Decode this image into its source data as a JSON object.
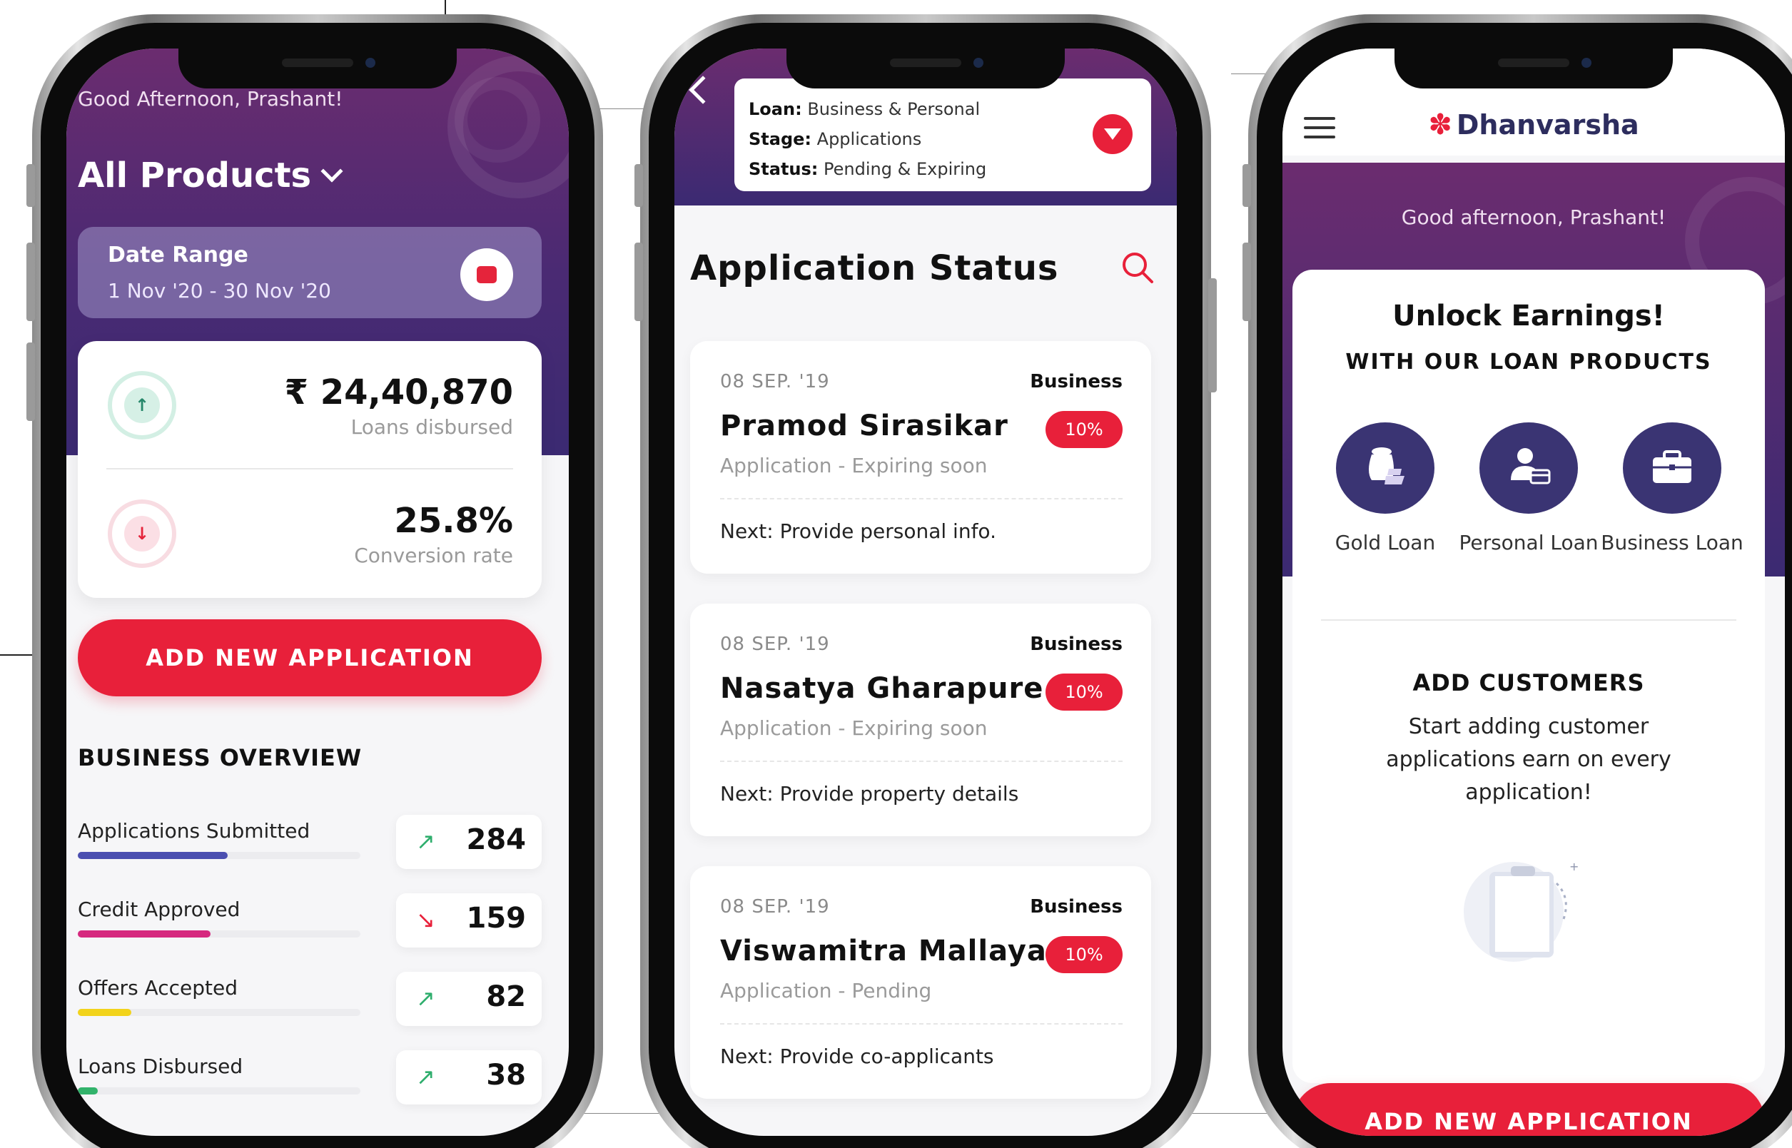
{
  "colors": {
    "brand_red": "#e8203a",
    "brand_purple": "#4a2a73",
    "navy_icon": "#3a3473"
  },
  "dashboard": {
    "greeting": "Good Afternoon, Prashant!",
    "product_selector": "All Products",
    "date_range": {
      "title": "Date Range",
      "value": "1 Nov '20 - 30 Nov '20"
    },
    "stats": [
      {
        "value": "₹ 24,40,870",
        "label": "Loans disbursed",
        "icon": "arrow-up-icon"
      },
      {
        "value": "25.8%",
        "label": "Conversion rate",
        "icon": "arrow-down-icon"
      }
    ],
    "add_button": "ADD NEW APPLICATION",
    "overview_title": "BUSINESS OVERVIEW",
    "overview": [
      {
        "label": "Applications Submitted",
        "value": "284",
        "trend": "up",
        "progress": 0.53,
        "color": "#4b4fb0"
      },
      {
        "label": "Credit Approved",
        "value": "159",
        "trend": "down",
        "progress": 0.47,
        "color": "#d6297f"
      },
      {
        "label": "Offers Accepted",
        "value": "82",
        "trend": "up",
        "progress": 0.19,
        "color": "#f2d31b"
      },
      {
        "label": "Loans Disbursed",
        "value": "38",
        "trend": "up",
        "progress": 0.07,
        "color": "#32b36b"
      }
    ]
  },
  "status_screen": {
    "filter": {
      "loan_label": "Loan:",
      "loan_value": "Business & Personal",
      "stage_label": "Stage:",
      "stage_value": "Applications",
      "status_label": "Status:",
      "status_value": "Pending & Expiring"
    },
    "title": "Application Status",
    "applications": [
      {
        "date": "08 SEP. '19",
        "type": "Business",
        "name": "Pramod Sirasikar",
        "badge": "10%",
        "status": "Application - Expiring soon",
        "next": "Next: Provide personal info."
      },
      {
        "date": "08 SEP. '19",
        "type": "Business",
        "name": "Nasatya Gharapure",
        "badge": "10%",
        "status": "Application - Expiring soon",
        "next": "Next: Provide property details"
      },
      {
        "date": "08 SEP. '19",
        "type": "Business",
        "name": "Viswamitra Mallaya",
        "badge": "10%",
        "status": "Application - Pending",
        "next": "Next: Provide co-applicants"
      }
    ]
  },
  "home": {
    "brand": "Dhanvarsha",
    "greeting": "Good afternoon, Prashant!",
    "earn_title": "Unlock Earnings!",
    "earn_subtitle": "WITH OUR LOAN PRODUCTS",
    "loans": [
      {
        "label": "Gold Loan",
        "icon": "gold-loan-icon"
      },
      {
        "label": "Personal Loan",
        "icon": "personal-loan-icon"
      },
      {
        "label": "Business Loan",
        "icon": "business-loan-icon"
      }
    ],
    "add_customers_title": "ADD CUSTOMERS",
    "add_customers_text": "Start adding customer applications earn on every application!",
    "add_button": "ADD NEW APPLICATION"
  }
}
